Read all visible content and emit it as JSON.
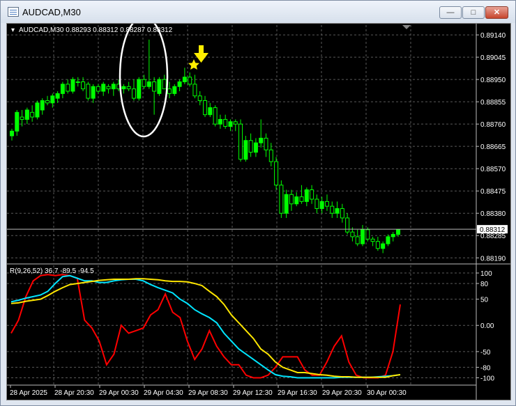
{
  "window": {
    "title": "AUDCAD,M30",
    "minimize_glyph": "—",
    "maximize_glyph": "□",
    "close_glyph": "✕"
  },
  "chart_header": {
    "text": "AUDCAD,M30  0.88293 0.88312 0.88287 0.88312"
  },
  "indicator_header": {
    "text": "R(9,26,52) 36.7 -89.5 -94.5"
  },
  "colors": {
    "background": "#000000",
    "bull_candle": "#00ff00",
    "bear_candle": "#000000",
    "grid": "#5a5a5a",
    "series_red": "#ff0000",
    "series_cyan": "#00e5ff",
    "series_yellow": "#ffe600",
    "marker": "#ffee00",
    "ellipse": "#ffffff"
  },
  "annotations": {
    "arrow": "down-arrow",
    "star": "star",
    "ellipse": "circled-candles"
  },
  "chart_data": [
    {
      "type": "candlestick",
      "title": "AUDCAD,M30",
      "ohlc_header": [
        0.88293,
        0.88312,
        0.88287,
        0.88312
      ],
      "ylim": [
        0.8817,
        0.8917
      ],
      "y_ticks": [
        "0.89140",
        "0.89045",
        "0.88950",
        "0.88855",
        "0.88760",
        "0.88665",
        "0.88570",
        "0.88475",
        "0.88380",
        "0.88285",
        "0.88190"
      ],
      "current_price": "0.88312",
      "x_tick_labels": [
        "28 Apr 2025",
        "28 Apr 20:30",
        "29 Apr 00:30",
        "29 Apr 04:30",
        "29 Apr 08:30",
        "29 Apr 12:30",
        "29 Apr 16:30",
        "29 Apr 20:30",
        "30 Apr 00:30"
      ],
      "candles": [
        [
          0.8871,
          0.8874,
          0.8869,
          0.8873
        ],
        [
          0.8873,
          0.8882,
          0.8871,
          0.8881
        ],
        [
          0.8879,
          0.8882,
          0.8875,
          0.8878
        ],
        [
          0.8878,
          0.8883,
          0.8876,
          0.8882
        ],
        [
          0.8881,
          0.8884,
          0.8877,
          0.8879
        ],
        [
          0.8879,
          0.8886,
          0.8878,
          0.8885
        ],
        [
          0.8882,
          0.8887,
          0.888,
          0.8886
        ],
        [
          0.8886,
          0.8888,
          0.8884,
          0.8885
        ],
        [
          0.8885,
          0.8889,
          0.8883,
          0.8888
        ],
        [
          0.8887,
          0.889,
          0.8885,
          0.8889
        ],
        [
          0.8889,
          0.8894,
          0.8887,
          0.8893
        ],
        [
          0.8893,
          0.8895,
          0.8889,
          0.889
        ],
        [
          0.889,
          0.8896,
          0.8889,
          0.8895
        ],
        [
          0.8894,
          0.8896,
          0.8892,
          0.8894
        ],
        [
          0.8894,
          0.8896,
          0.889,
          0.8891
        ],
        [
          0.8893,
          0.8894,
          0.8886,
          0.8887
        ],
        [
          0.8887,
          0.8893,
          0.8885,
          0.8892
        ],
        [
          0.8892,
          0.8893,
          0.8889,
          0.889
        ],
        [
          0.889,
          0.8894,
          0.8888,
          0.8893
        ],
        [
          0.8892,
          0.8893,
          0.8889,
          0.8891
        ],
        [
          0.8891,
          0.8894,
          0.8888,
          0.8893
        ],
        [
          0.8893,
          0.8895,
          0.889,
          0.8891
        ],
        [
          0.8891,
          0.8893,
          0.8889,
          0.8892
        ],
        [
          0.8892,
          0.8894,
          0.889,
          0.8891
        ],
        [
          0.8891,
          0.8895,
          0.8886,
          0.8887
        ],
        [
          0.8887,
          0.8896,
          0.8886,
          0.8895
        ],
        [
          0.8895,
          0.8897,
          0.8891,
          0.8892
        ],
        [
          0.8892,
          0.8912,
          0.8891,
          0.8894
        ],
        [
          0.8894,
          0.8896,
          0.888,
          0.889
        ],
        [
          0.8889,
          0.8896,
          0.8888,
          0.8895
        ],
        [
          0.8895,
          0.8897,
          0.8891,
          0.8891
        ],
        [
          0.8891,
          0.8894,
          0.8887,
          0.8889
        ],
        [
          0.8889,
          0.8893,
          0.8888,
          0.8892
        ],
        [
          0.8892,
          0.8895,
          0.889,
          0.8894
        ],
        [
          0.8894,
          0.89,
          0.8893,
          0.8896
        ],
        [
          0.8896,
          0.8898,
          0.8892,
          0.8893
        ],
        [
          0.8893,
          0.8897,
          0.8887,
          0.8888
        ],
        [
          0.8888,
          0.889,
          0.8884,
          0.8886
        ],
        [
          0.8886,
          0.8888,
          0.8879,
          0.888
        ],
        [
          0.888,
          0.8885,
          0.8879,
          0.8883
        ],
        [
          0.8883,
          0.8884,
          0.8875,
          0.8876
        ],
        [
          0.8876,
          0.888,
          0.8874,
          0.8878
        ],
        [
          0.8878,
          0.888,
          0.8874,
          0.8875
        ],
        [
          0.8875,
          0.8878,
          0.8873,
          0.8877
        ],
        [
          0.8877,
          0.8878,
          0.8873,
          0.8876
        ],
        [
          0.8876,
          0.8878,
          0.886,
          0.8861
        ],
        [
          0.8861,
          0.8871,
          0.886,
          0.8869
        ],
        [
          0.8869,
          0.8872,
          0.8862,
          0.8864
        ],
        [
          0.8864,
          0.887,
          0.8862,
          0.8868
        ],
        [
          0.8868,
          0.8878,
          0.8866,
          0.887
        ],
        [
          0.887,
          0.8872,
          0.8862,
          0.8865
        ],
        [
          0.8865,
          0.8868,
          0.8858,
          0.886
        ],
        [
          0.886,
          0.8862,
          0.8848,
          0.885
        ],
        [
          0.885,
          0.8852,
          0.8836,
          0.8838
        ],
        [
          0.8838,
          0.8848,
          0.8836,
          0.8846
        ],
        [
          0.8846,
          0.8848,
          0.8839,
          0.8842
        ],
        [
          0.8842,
          0.8847,
          0.8841,
          0.8845
        ],
        [
          0.8845,
          0.885,
          0.8842,
          0.8843
        ],
        [
          0.8843,
          0.8849,
          0.8841,
          0.8848
        ],
        [
          0.8848,
          0.885,
          0.8842,
          0.8844
        ],
        [
          0.8844,
          0.8846,
          0.8838,
          0.884
        ],
        [
          0.884,
          0.8845,
          0.8838,
          0.8843
        ],
        [
          0.8843,
          0.8846,
          0.8839,
          0.8841
        ],
        [
          0.8841,
          0.8843,
          0.8836,
          0.8838
        ],
        [
          0.8838,
          0.8843,
          0.8836,
          0.884
        ],
        [
          0.884,
          0.8842,
          0.8834,
          0.8836
        ],
        [
          0.8836,
          0.8838,
          0.8829,
          0.883
        ],
        [
          0.883,
          0.8832,
          0.8826,
          0.8828
        ],
        [
          0.8828,
          0.8831,
          0.8824,
          0.8825
        ],
        [
          0.8825,
          0.8833,
          0.8824,
          0.8831
        ],
        [
          0.8831,
          0.8832,
          0.8826,
          0.8827
        ],
        [
          0.8827,
          0.8828,
          0.8824,
          0.8826
        ],
        [
          0.8826,
          0.8828,
          0.8822,
          0.8823
        ],
        [
          0.8823,
          0.8826,
          0.8821,
          0.8825
        ],
        [
          0.8825,
          0.8829,
          0.8824,
          0.8828
        ],
        [
          0.8828,
          0.883,
          0.8826,
          0.8829
        ],
        [
          0.8829,
          0.8831,
          0.8828,
          0.8831
        ]
      ]
    },
    {
      "type": "line",
      "title": "R(9,26,52)",
      "header_values": [
        36.7,
        -89.5,
        -94.5
      ],
      "ylim": [
        -110,
        108
      ],
      "y_ticks": [
        "100",
        "80",
        "50",
        "0.00",
        "-50",
        "-80",
        "-100"
      ],
      "series": [
        {
          "color": "#ff0000",
          "values": [
            -15,
            10,
            55,
            85,
            95,
            97,
            95,
            97,
            95,
            90,
            10,
            -5,
            -30,
            -75,
            -55,
            0,
            -15,
            -10,
            -5,
            20,
            30,
            60,
            25,
            15,
            -30,
            -65,
            -45,
            -10,
            -40,
            -60,
            -75,
            -75,
            -95,
            -100,
            -100,
            -95,
            -80,
            -60,
            -60,
            -60,
            -85,
            -95,
            -95,
            -70,
            -40,
            -20,
            -70,
            -95,
            -100,
            -100,
            -100,
            -95,
            -50,
            40
          ]
        },
        {
          "color": "#00e5ff",
          "values": [
            45,
            48,
            52,
            55,
            58,
            65,
            80,
            93,
            95,
            90,
            85,
            85,
            82,
            82,
            85,
            87,
            88,
            88,
            85,
            78,
            72,
            67,
            62,
            50,
            42,
            30,
            22,
            15,
            5,
            -15,
            -30,
            -45,
            -55,
            -65,
            -75,
            -85,
            -94,
            -97,
            -98,
            -100,
            -100,
            -100,
            -100,
            -100,
            -100,
            -99,
            -99,
            -99,
            -99,
            -99,
            -98,
            -97,
            -96,
            -94
          ]
        },
        {
          "color": "#ffe600",
          "values": [
            42,
            43,
            46,
            48,
            50,
            57,
            65,
            72,
            78,
            80,
            82,
            84,
            86,
            87,
            88,
            88,
            88,
            89,
            89,
            88,
            87,
            85,
            84,
            84,
            83,
            80,
            76,
            65,
            55,
            40,
            20,
            5,
            -10,
            -25,
            -45,
            -55,
            -70,
            -80,
            -85,
            -90,
            -90,
            -92,
            -94,
            -95,
            -97,
            -98,
            -98,
            -99,
            -99,
            -99,
            -99,
            -99,
            -96,
            -94
          ]
        }
      ]
    }
  ]
}
